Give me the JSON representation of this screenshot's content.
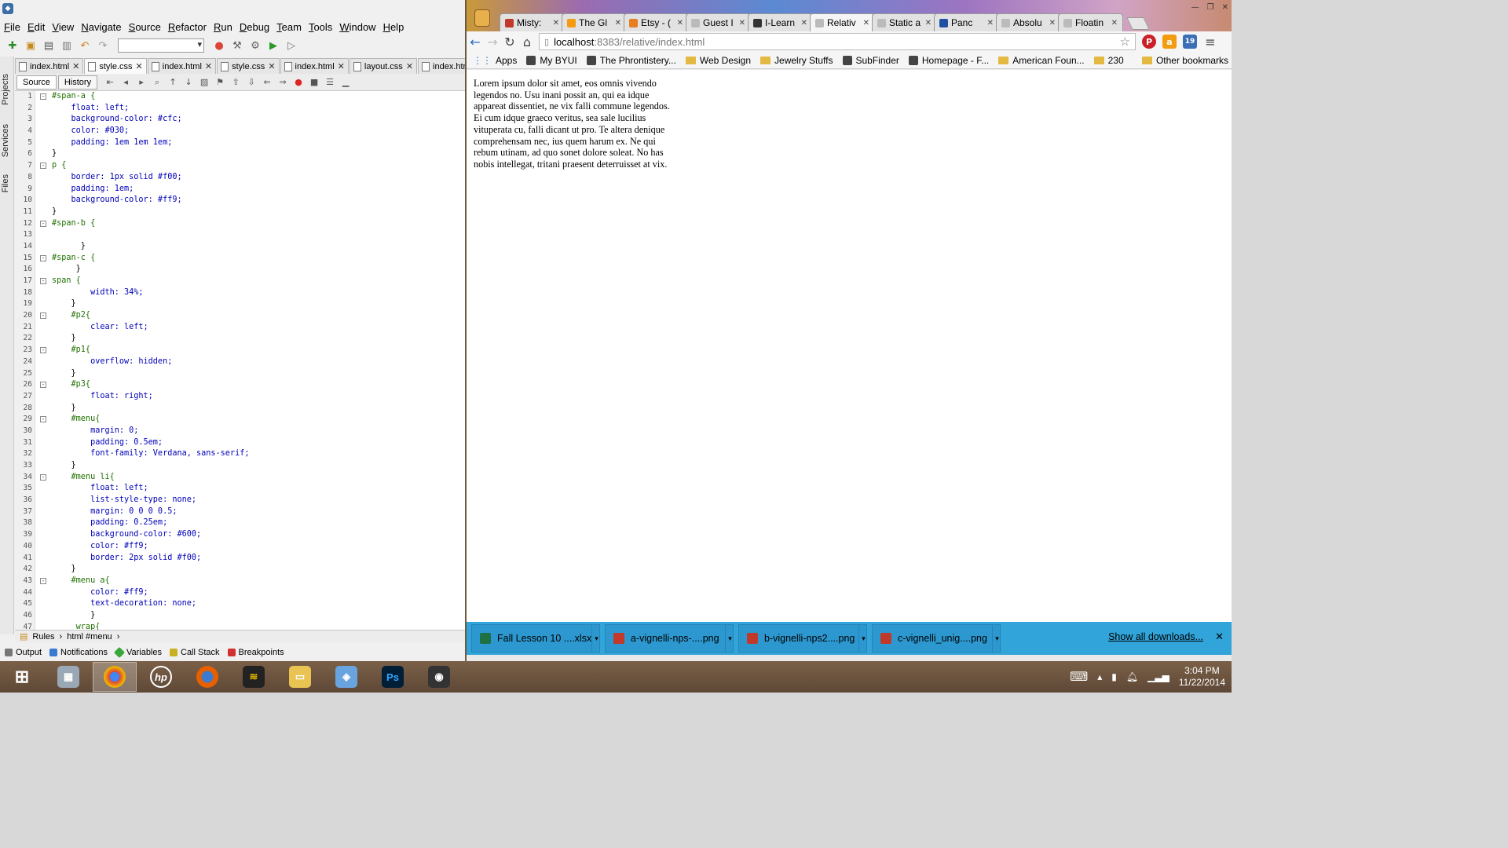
{
  "ide": {
    "menu": [
      "File",
      "Edit",
      "View",
      "Navigate",
      "Source",
      "Refactor",
      "Run",
      "Debug",
      "Team",
      "Tools",
      "Window",
      "Help"
    ],
    "rail": [
      "Projects",
      "Services",
      "Files"
    ],
    "tabs": [
      {
        "label": "index.html",
        "active": false
      },
      {
        "label": "style.css",
        "active": true
      },
      {
        "label": "index.html",
        "active": false
      },
      {
        "label": "style.css",
        "active": false
      },
      {
        "label": "index.html",
        "active": false
      },
      {
        "label": "layout.css",
        "active": false
      },
      {
        "label": "index.html",
        "active": false
      }
    ],
    "source_tab": "Source",
    "history_tab": "History",
    "code": [
      {
        "n": "1",
        "t": "#span-a {",
        "f": "-"
      },
      {
        "n": "2",
        "t": "    float: left;"
      },
      {
        "n": "3",
        "t": "    background-color: #cfc;"
      },
      {
        "n": "4",
        "t": "    color: #030;"
      },
      {
        "n": "5",
        "t": "    padding: 1em 1em 1em;"
      },
      {
        "n": "6",
        "t": "}"
      },
      {
        "n": "7",
        "t": "p {",
        "f": "-"
      },
      {
        "n": "8",
        "t": "    border: 1px solid #f00;"
      },
      {
        "n": "9",
        "t": "    padding: 1em;"
      },
      {
        "n": "10",
        "t": "    background-color: #ff9;"
      },
      {
        "n": "11",
        "t": "}"
      },
      {
        "n": "12",
        "t": "#span-b {",
        "f": "-"
      },
      {
        "n": "13",
        "t": ""
      },
      {
        "n": "14",
        "t": "      }"
      },
      {
        "n": "15",
        "t": "#span-c {",
        "f": "-"
      },
      {
        "n": "16",
        "t": "     }"
      },
      {
        "n": "17",
        "t": "span {",
        "f": "-"
      },
      {
        "n": "18",
        "t": "        width: 34%;"
      },
      {
        "n": "19",
        "t": "    }"
      },
      {
        "n": "20",
        "t": "    #p2{",
        "f": "-"
      },
      {
        "n": "21",
        "t": "        clear: left;"
      },
      {
        "n": "22",
        "t": "    }"
      },
      {
        "n": "23",
        "t": "    #p1{",
        "f": "-"
      },
      {
        "n": "24",
        "t": "        overflow: hidden;"
      },
      {
        "n": "25",
        "t": "    }"
      },
      {
        "n": "26",
        "t": "    #p3{",
        "f": "-"
      },
      {
        "n": "27",
        "t": "        float: right;"
      },
      {
        "n": "28",
        "t": "    }"
      },
      {
        "n": "29",
        "t": "    #menu{",
        "f": "-"
      },
      {
        "n": "30",
        "t": "        margin: 0;"
      },
      {
        "n": "31",
        "t": "        padding: 0.5em;"
      },
      {
        "n": "32",
        "t": "        font-family: Verdana, sans-serif;"
      },
      {
        "n": "33",
        "t": "    }"
      },
      {
        "n": "34",
        "t": "    #menu li{",
        "f": "-"
      },
      {
        "n": "35",
        "t": "        float: left;"
      },
      {
        "n": "36",
        "t": "        list-style-type: none;"
      },
      {
        "n": "37",
        "t": "        margin: 0 0 0 0.5;"
      },
      {
        "n": "38",
        "t": "        padding: 0.25em;"
      },
      {
        "n": "39",
        "t": "        background-color: #600;"
      },
      {
        "n": "40",
        "t": "        color: #ff9;"
      },
      {
        "n": "41",
        "t": "        border: 2px solid #f00;"
      },
      {
        "n": "42",
        "t": "    }"
      },
      {
        "n": "43",
        "t": "    #menu a{",
        "f": "-"
      },
      {
        "n": "44",
        "t": "        color: #ff9;"
      },
      {
        "n": "45",
        "t": "        text-decoration: none;"
      },
      {
        "n": "46",
        "t": "        }"
      },
      {
        "n": "47",
        "t": "     wrap{"
      }
    ],
    "breadcrumb": [
      "Rules",
      "html #menu"
    ],
    "bottom_tabs": [
      "Output",
      "Notifications",
      "Variables",
      "Call Stack",
      "Breakpoints"
    ]
  },
  "browser": {
    "tabs": [
      {
        "label": "Misty:",
        "fav": "#c0392b",
        "active": false
      },
      {
        "label": "The Gl",
        "fav": "#f39c12",
        "active": false
      },
      {
        "label": "Etsy - (",
        "fav": "#e67e22",
        "active": false
      },
      {
        "label": "Guest I",
        "fav": "#bbbbbb",
        "active": false
      },
      {
        "label": "I-Learn",
        "fav": "#333333",
        "active": false
      },
      {
        "label": "Relativ",
        "fav": "#bbbbbb",
        "active": true
      },
      {
        "label": "Static a",
        "fav": "#bbbbbb",
        "active": false
      },
      {
        "label": "Panc",
        "fav": "#1e4fa3",
        "active": false
      },
      {
        "label": "Absolu",
        "fav": "#bbbbbb",
        "active": false
      },
      {
        "label": "Floatin",
        "fav": "#bbbbbb",
        "active": false
      }
    ],
    "url_host": "localhost",
    "url_path": ":8383/relative/index.html",
    "bookmarks": [
      "Apps",
      "My BYUI",
      "The Phrontistery...",
      "Web Design",
      "Jewelry Stuffs",
      "SubFinder",
      "Homepage - F...",
      "American Foun...",
      "230"
    ],
    "other_bookmarks": "Other bookmarks",
    "lorem": "Lorem ipsum dolor sit amet, eos omnis vivendo legendos no. Usu inani possit an, qui ea idque appareat dissentiet, ne vix falli commune legendos. Ei cum idque graeco veritus, sea sale lucilius vituperata cu, falli dicant ut pro. Te altera denique comprehensam nec, ius quem harum ex. Ne qui rebum utinam, ad quo sonet dolore soleat. No has nobis intellegat, tritani praesent deterruisset at vix.",
    "downloads": [
      "Fall Lesson 10 ....xlsx",
      "a-vignelli-nps-....png",
      "b-vignelli-nps2....png",
      "c-vignelli_unig....png"
    ],
    "show_all": "Show all downloads..."
  },
  "taskbar": {
    "time": "3:04 PM",
    "date": "11/22/2014",
    "pinterest_badge": "19"
  }
}
